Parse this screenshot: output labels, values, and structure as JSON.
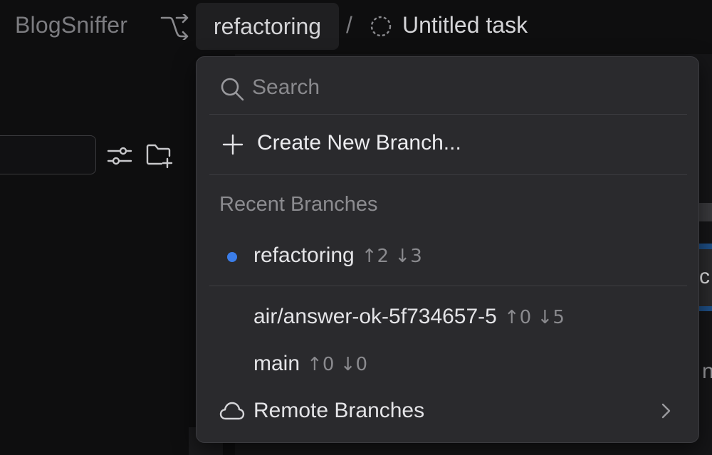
{
  "header": {
    "project_name": "BlogSniffer",
    "branch_name": "refactoring",
    "separator": "/",
    "task_title": "Untitled task"
  },
  "branch_menu": {
    "search_placeholder": "Search",
    "create_label": "Create New Branch...",
    "recent_header": "Recent Branches",
    "recent_branches": [
      {
        "name": "refactoring",
        "ahead": "↑2",
        "behind": "↓3",
        "current": true
      },
      {
        "name": "air/answer-ok-5f734657-5",
        "ahead": "↑0",
        "behind": "↓5",
        "current": false
      },
      {
        "name": "main",
        "ahead": "↑0",
        "behind": "↓0",
        "current": false
      }
    ],
    "remote_label": "Remote Branches"
  },
  "background": {
    "right_button_letter": "c",
    "right_text_letter": "n"
  },
  "colors": {
    "current_branch_dot": "#3b7de8",
    "menu_background": "#2a2a2d",
    "app_background": "#0e0e0f"
  },
  "icons": {
    "branch": "git-branch-icon",
    "task_status": "dashed-circle-icon",
    "filter": "sliders-icon",
    "new_folder": "folder-plus-icon",
    "search": "search-icon",
    "create": "plus-icon",
    "remote": "cloud-icon",
    "submenu": "chevron-right-icon"
  }
}
